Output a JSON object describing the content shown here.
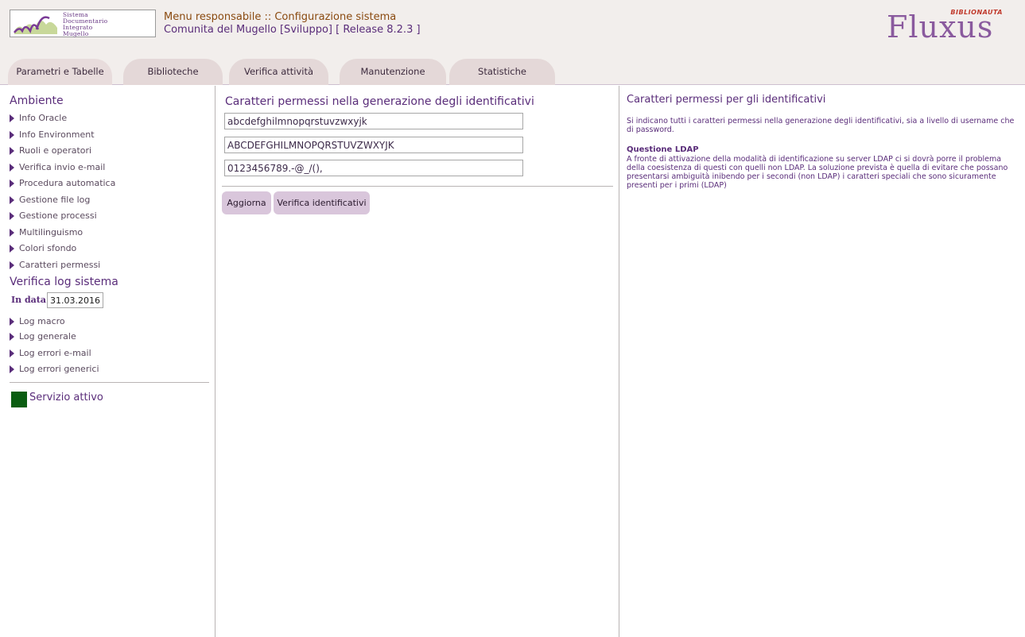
{
  "header": {
    "logo_lines": [
      "Sistema",
      "Documentario",
      "Integrato",
      "Mugello"
    ],
    "title_line1": "Menu responsabile :: Configurazione sistema",
    "title_line2": "Comunita del Mugello [Sviluppo] [ Release 8.2.3 ]",
    "brand_name": "Fluxus",
    "brand_sub": "BIBLIONAUTA"
  },
  "tabs": [
    {
      "label": "Parametri e Tabelle"
    },
    {
      "label": "Biblioteche"
    },
    {
      "label": "Verifica attività"
    },
    {
      "label": "Manutenzione"
    },
    {
      "label": "Statistiche"
    }
  ],
  "sidebar": {
    "section1_title": "Ambiente",
    "section1_items": [
      {
        "label": "Info Oracle"
      },
      {
        "label": "Info Environment"
      },
      {
        "label": "Ruoli e operatori"
      },
      {
        "label": "Verifica invio e-mail"
      },
      {
        "label": "Procedura automatica"
      },
      {
        "label": "Gestione file log"
      },
      {
        "label": "Gestione processi"
      },
      {
        "label": "Multilinguismo"
      },
      {
        "label": "Colori sfondo"
      },
      {
        "label": "Caratteri permessi"
      }
    ],
    "section2_title": "Verifica log sistema",
    "date_label": "In data",
    "date_value": "31.03.2016",
    "section2_items": [
      {
        "label": "Log macro"
      },
      {
        "label": "Log generale"
      },
      {
        "label": "Log errori e-mail"
      },
      {
        "label": "Log errori generici"
      }
    ],
    "status_text": "Servizio attivo",
    "status_color": "#0a5d11"
  },
  "main": {
    "title": "Caratteri permessi nella generazione degli identificativi",
    "lowercase_value": "abcdefghilmnopqrstuvzwxyjk",
    "uppercase_value": "ABCDEFGHILMNOPQRSTUVZWXYJK",
    "special_value": "0123456789.-@_/(),",
    "update_button": "Aggiorna",
    "verify_button": "Verifica identificativi"
  },
  "help": {
    "title": "Caratteri permessi per gli identificativi",
    "description": "Si indicano tutti i caratteri permessi nella generazione degli identificativi, sia a livello di username che di password.",
    "ldap_title": "Questione LDAP",
    "ldap_body": "A fronte di attivazione della modalità di identificazione su server LDAP ci si dovrà porre il problema della coesistenza di questi con quelli non LDAP. La soluzione prevista è quella di evitare che possano presentarsi ambiguità inibendo per i secondi (non LDAP) i caratteri speciali che sono sicuramente presenti per i primi (LDAP)"
  },
  "colors": {
    "header_bg": "#f2eeec",
    "tab_bg": "#e4d8d8",
    "button_bg": "#d9c6db",
    "text_purple": "#5a2d7a",
    "title_orange": "#8a4a10"
  }
}
